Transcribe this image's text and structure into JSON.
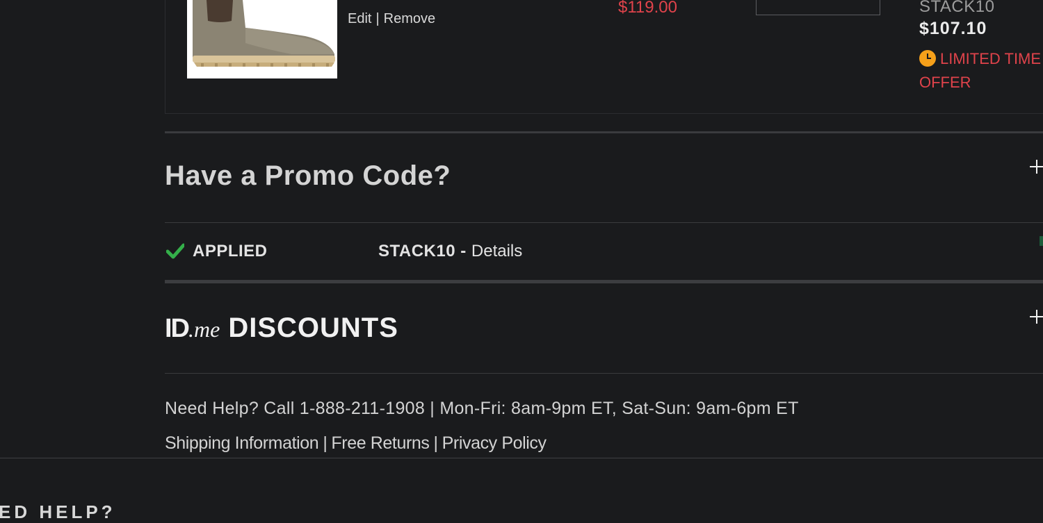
{
  "cart_item": {
    "actions": {
      "edit": "Edit",
      "separator": "|",
      "remove": "Remove"
    },
    "original_price": "$119.00",
    "promo_code_applied": "STACK10",
    "discounted_price": "$107.10",
    "offer_label": "LIMITED TIME OFFER"
  },
  "promo_section": {
    "heading": "Have a Promo Code?",
    "applied_label": "APPLIED",
    "applied_code": "STACK10",
    "code_separator": " - ",
    "details_link": "Details"
  },
  "idme_section": {
    "logo_id": "ID",
    "logo_me": ".me",
    "title": "DISCOUNTS"
  },
  "help": {
    "text": "Need Help? Call 1-888-211-1908 | Mon-Fri: 8am-9pm ET, Sat-Sun: 9am-6pm ET"
  },
  "footer_links": {
    "shipping": "Shipping Information",
    "returns": "Free Returns",
    "privacy": "Privacy Policy",
    "separator": "|"
  },
  "bottom_heading": "ED HELP?",
  "colors": {
    "background": "#1a1b1d",
    "sale_red": "#e0434b",
    "check_green": "#34b04a",
    "clock_orange": "#f5a01a"
  },
  "icons": [
    "clock-icon",
    "plus-icon",
    "check-icon"
  ]
}
